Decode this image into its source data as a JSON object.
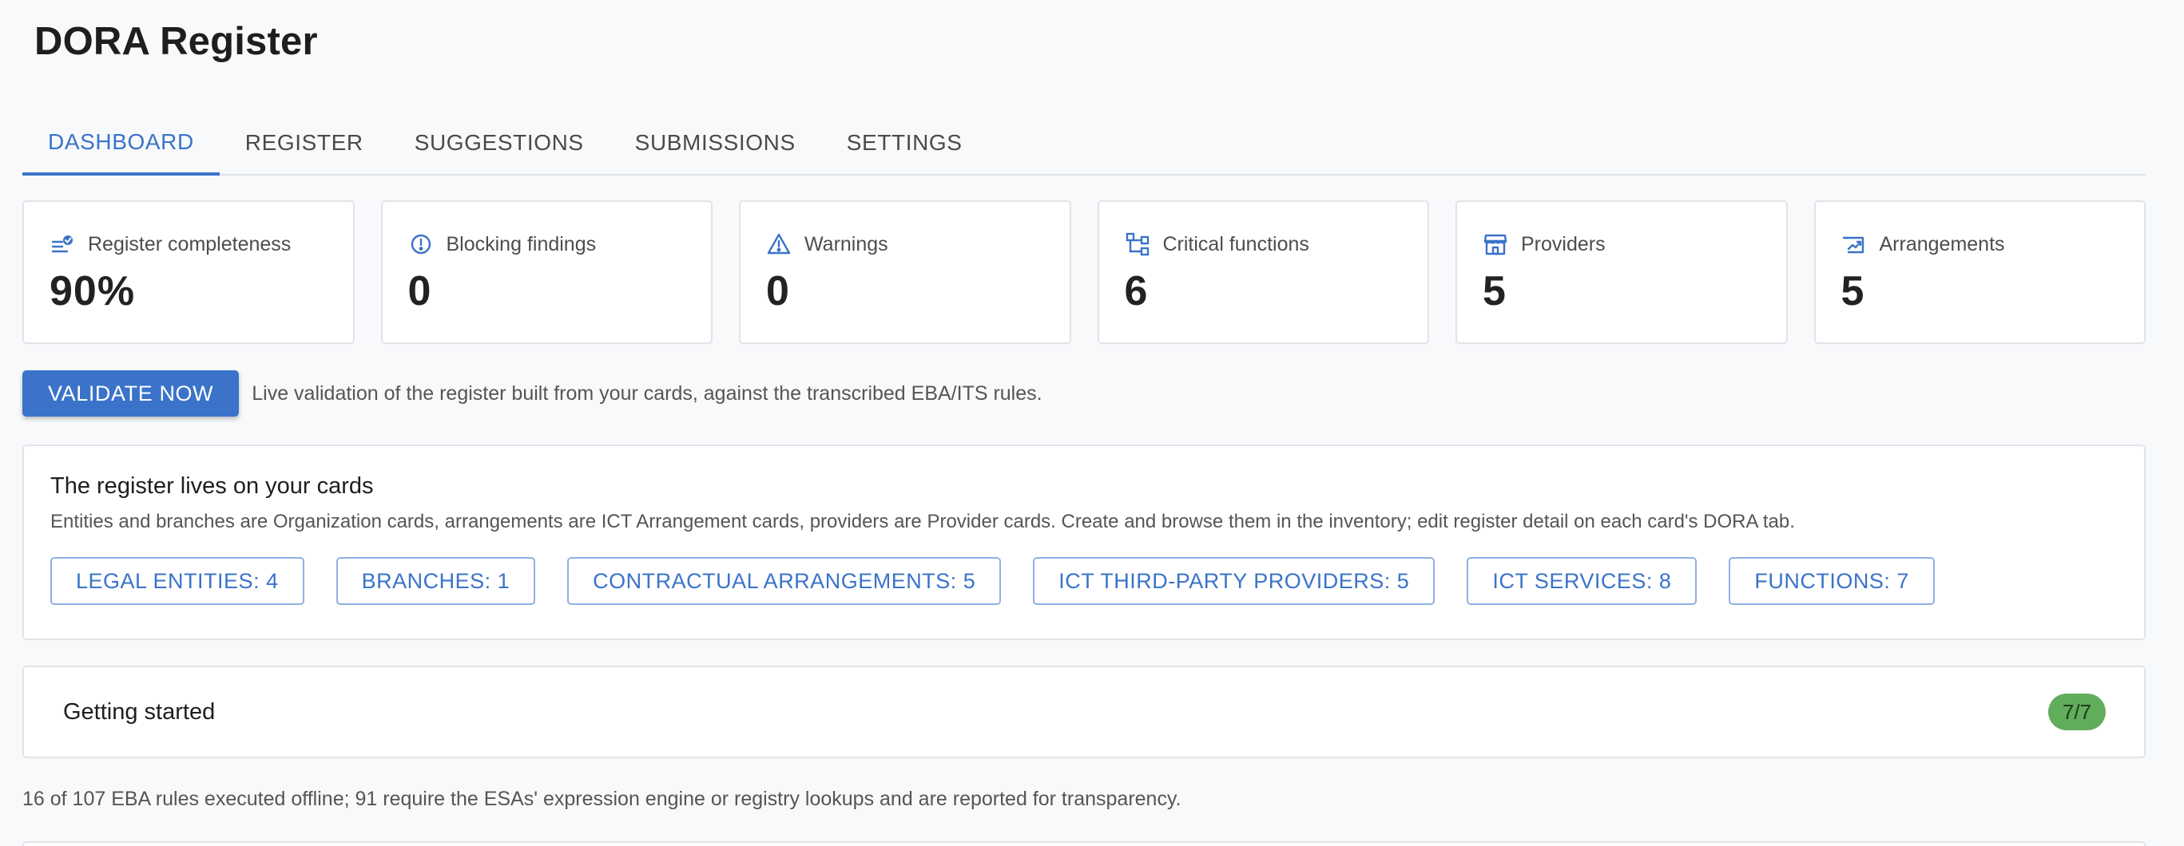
{
  "app": {
    "title": "DORA Register"
  },
  "tabs": [
    {
      "label": "DASHBOARD",
      "active": true
    },
    {
      "label": "REGISTER",
      "active": false
    },
    {
      "label": "SUGGESTIONS",
      "active": false
    },
    {
      "label": "SUBMISSIONS",
      "active": false
    },
    {
      "label": "SETTINGS",
      "active": false
    }
  ],
  "stats": [
    {
      "icon": "checklist-icon",
      "label": "Register completeness",
      "value": "90%"
    },
    {
      "icon": "alert-circle-icon",
      "label": "Blocking findings",
      "value": "0"
    },
    {
      "icon": "warning-triangle-icon",
      "label": "Warnings",
      "value": "0"
    },
    {
      "icon": "hierarchy-icon",
      "label": "Critical functions",
      "value": "6"
    },
    {
      "icon": "storefront-icon",
      "label": "Providers",
      "value": "5"
    },
    {
      "icon": "contract-icon",
      "label": "Arrangements",
      "value": "5"
    }
  ],
  "validate": {
    "button_label": "VALIDATE NOW",
    "note": "Live validation of the register built from your cards, against the transcribed EBA/ITS rules."
  },
  "cards_panel": {
    "title": "The register lives on your cards",
    "description": "Entities and branches are Organization cards, arrangements are ICT Arrangement cards, providers are Provider cards. Create and browse them in the inventory; edit register detail on each card's DORA tab.",
    "chips": [
      "LEGAL ENTITIES: 4",
      "BRANCHES: 1",
      "CONTRACTUAL ARRANGEMENTS: 5",
      "ICT THIRD-PARTY PROVIDERS: 5",
      "ICT SERVICES: 8",
      "FUNCTIONS: 7"
    ]
  },
  "getting_started": {
    "title": "Getting started",
    "badge": "7/7"
  },
  "footer_note": "16 of 107 EBA rules executed offline; 91 require the ESAs' expression engine or registry lookups and are reported for transparency.",
  "colors": {
    "accent": "#3a73c9",
    "success": "#62ad5c",
    "border": "#e0e3e8",
    "background": "#f8f9fb"
  }
}
